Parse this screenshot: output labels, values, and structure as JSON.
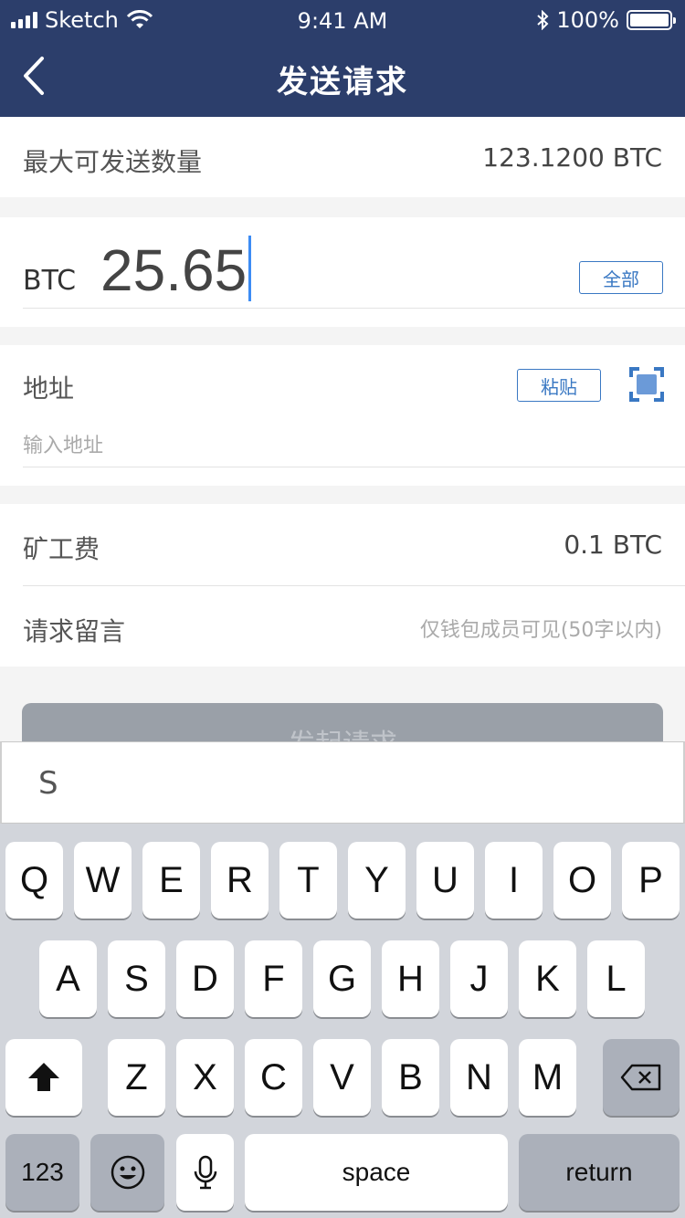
{
  "status": {
    "carrier": "Sketch",
    "time": "9:41 AM",
    "battery": "100%"
  },
  "nav": {
    "title": "发送请求"
  },
  "max_send": {
    "label": "最大可发送数量",
    "value": "123.1200 BTC"
  },
  "amount": {
    "currency": "BTC",
    "value": "25.65",
    "all_button": "全部"
  },
  "address": {
    "label": "地址",
    "paste_button": "粘贴",
    "placeholder": "输入地址"
  },
  "miner_fee": {
    "label": "矿工费",
    "value": "0.1 BTC"
  },
  "message": {
    "label": "请求留言",
    "placeholder": "仅钱包成员可见(50字以内)"
  },
  "submit": {
    "label": "发起请求"
  },
  "keyboard": {
    "suggestion": "S",
    "row1": [
      "Q",
      "W",
      "E",
      "R",
      "T",
      "Y",
      "U",
      "I",
      "O",
      "P"
    ],
    "row2": [
      "A",
      "S",
      "D",
      "F",
      "G",
      "H",
      "J",
      "K",
      "L"
    ],
    "row3": [
      "Z",
      "X",
      "C",
      "V",
      "B",
      "N",
      "M"
    ],
    "numbers_label": "123",
    "space_label": "space",
    "return_label": "return"
  },
  "colors": {
    "nav_bg": "#2c3e6b",
    "accent": "#3a78c3",
    "cursor": "#3c8cf4"
  }
}
